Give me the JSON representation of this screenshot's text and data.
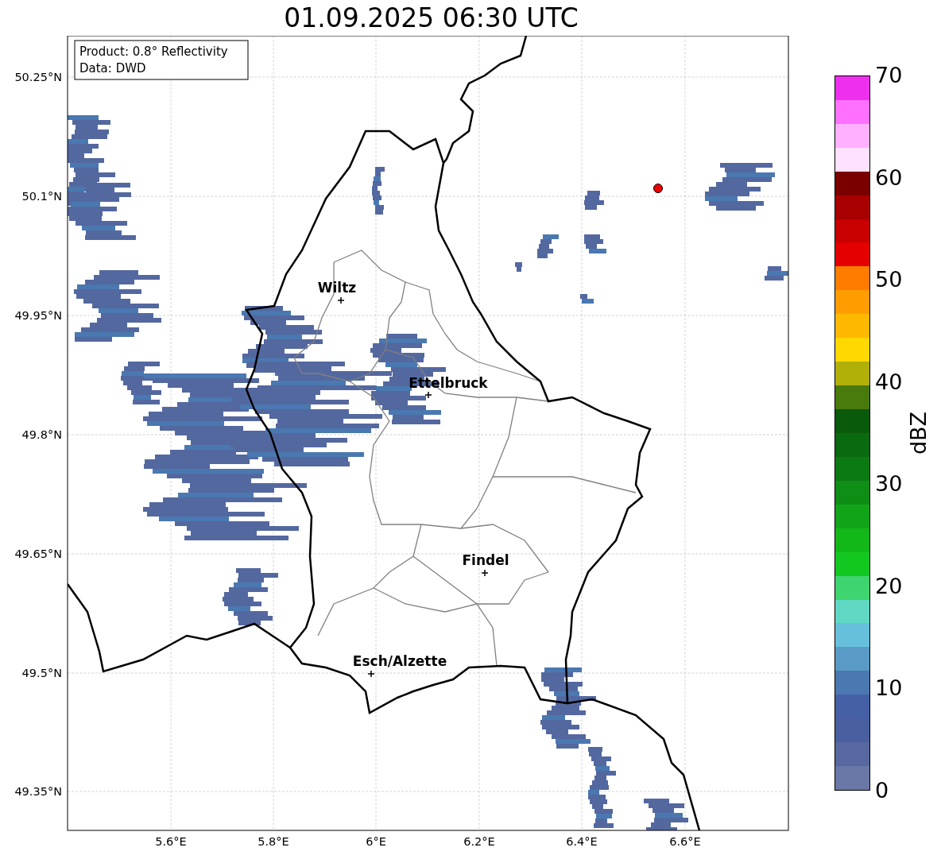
{
  "title": "01.09.2025 06:30 UTC",
  "info_box": [
    "Product: 0.8° Reflectivity",
    "Data: DWD"
  ],
  "y_ticks": [
    "50.25°N",
    "50.1°N",
    "49.95°N",
    "49.8°N",
    "49.65°N",
    "49.5°N",
    "49.35°N"
  ],
  "x_ticks": [
    "5.6°E",
    "5.8°E",
    "6°E",
    "6.2°E",
    "6.4°E",
    "6.6°E"
  ],
  "cities": [
    {
      "name": "Wiltz"
    },
    {
      "name": "Ettelbruck"
    },
    {
      "name": "Findel"
    },
    {
      "name": "Esch/Alzette"
    }
  ],
  "colorbar": {
    "label": "dBZ",
    "ticks": [
      "70",
      "60",
      "50",
      "40",
      "30",
      "20",
      "10",
      "0"
    ]
  }
}
